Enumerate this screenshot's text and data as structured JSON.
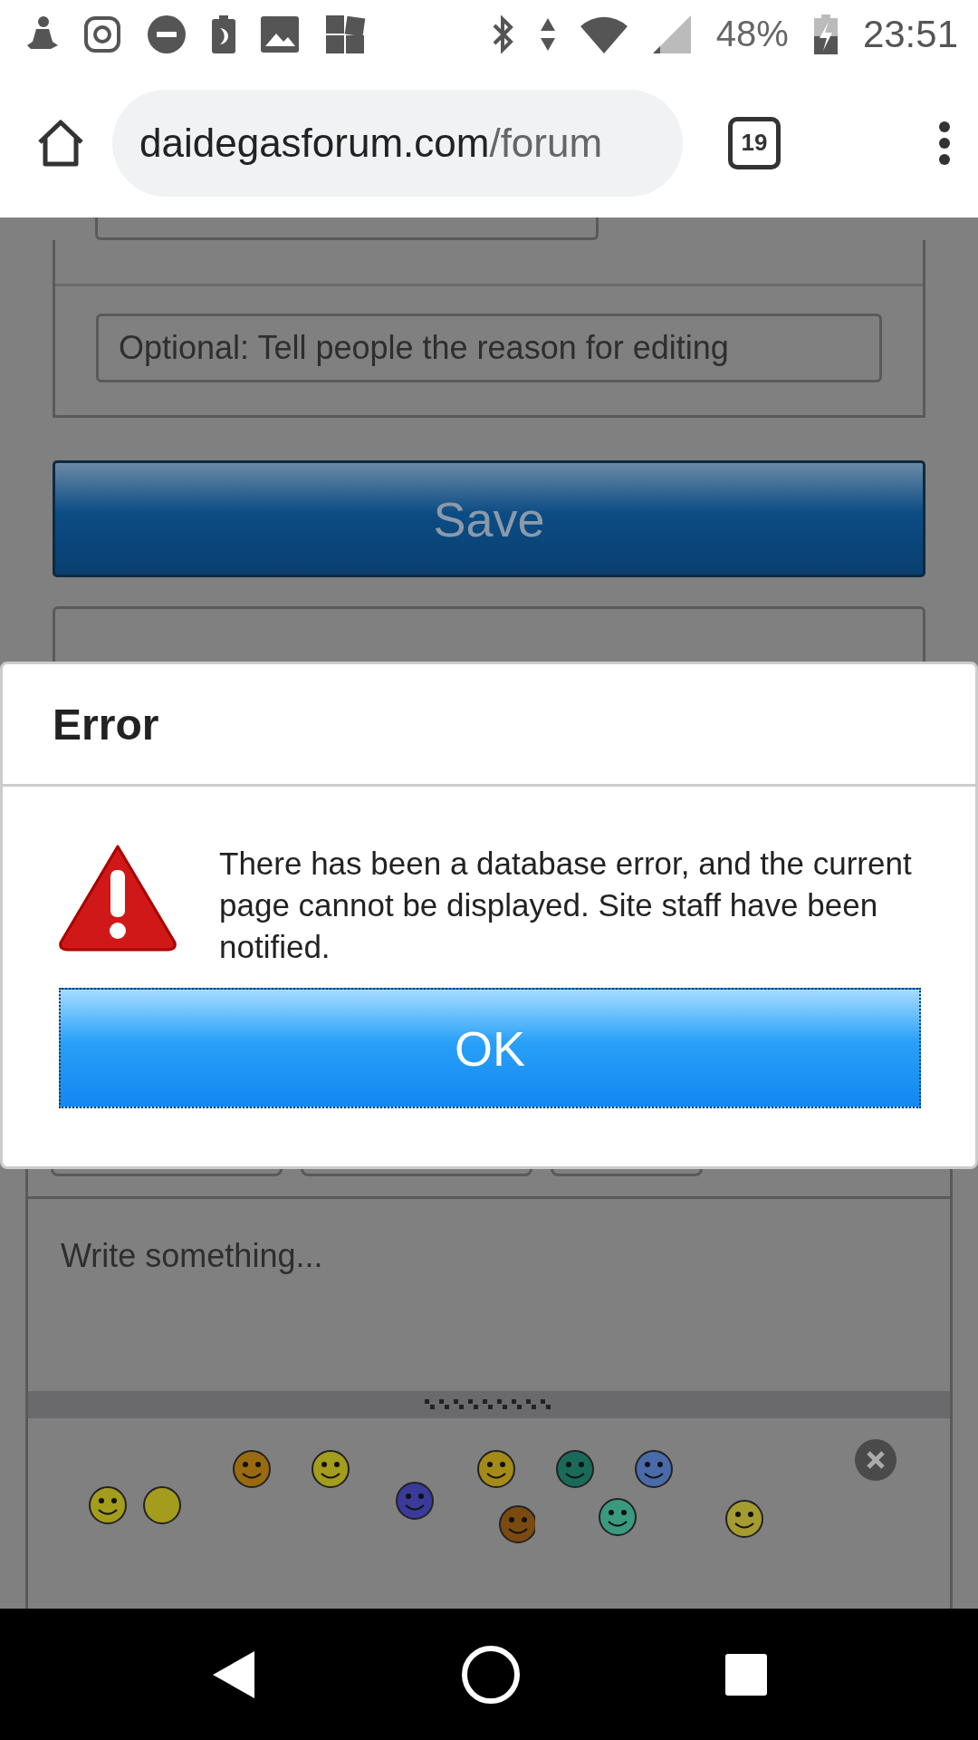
{
  "status_bar": {
    "battery": "48%",
    "time": "23:51"
  },
  "browser": {
    "url_host": "daidegasforum.com",
    "url_path": "/forum",
    "tab_count": "19"
  },
  "form": {
    "reason_placeholder": "Optional: Tell people the reason for editing",
    "save_label": "Save",
    "editor_placeholder": "Write something..."
  },
  "dialog": {
    "title": "Error",
    "message": "There has been a database error, and the current page cannot be displayed. Site staff have been notified.",
    "ok_label": "OK"
  }
}
